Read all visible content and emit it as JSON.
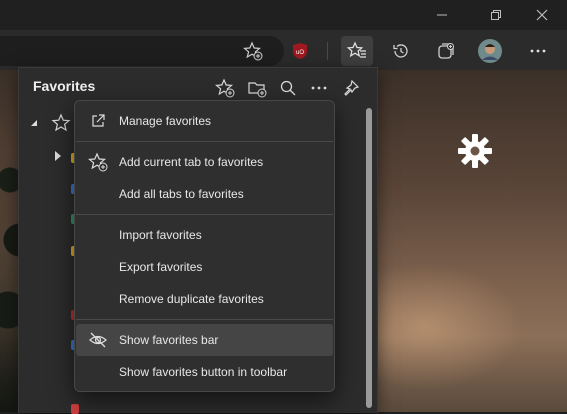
{
  "window": {
    "controls": {
      "minimize": "minimize-icon",
      "restore": "restore-icon",
      "close": "close-icon"
    }
  },
  "toolbar": {
    "icons": [
      "add-favorite-icon",
      "ublock-icon",
      "favorites-icon",
      "history-icon",
      "collections-icon",
      "profile-avatar",
      "more-icon"
    ],
    "extension_badge": "uO"
  },
  "favorites": {
    "title": "Favorites",
    "header_icons": [
      "add-favorite-icon",
      "add-folder-icon",
      "search-icon",
      "more-icon",
      "pin-icon"
    ]
  },
  "menu": {
    "items": [
      {
        "label": "Manage favorites",
        "icon": "external-link-icon"
      },
      {
        "label": "Add current tab to favorites",
        "icon": "star-add-icon"
      },
      {
        "label": "Add all tabs to favorites",
        "icon": ""
      },
      {
        "label": "Import favorites",
        "icon": ""
      },
      {
        "label": "Export favorites",
        "icon": ""
      },
      {
        "label": "Remove duplicate favorites",
        "icon": ""
      },
      {
        "label": "Show favorites bar",
        "icon": "eye-off-icon",
        "highlighted": true
      },
      {
        "label": "Show favorites button in toolbar",
        "icon": ""
      }
    ]
  },
  "colors": {
    "accent_red": "#c0202a",
    "menu_bg": "#2f2f2f",
    "panel_bg": "#2c2c2c",
    "highlight": "#454545"
  }
}
